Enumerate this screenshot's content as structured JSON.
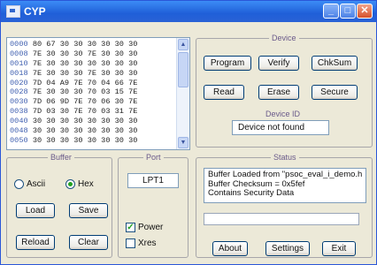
{
  "window": {
    "title": "CYP",
    "icon": "app-icon"
  },
  "hex_view": {
    "lines": [
      {
        "addr": "0000",
        "bytes": "80 67 30 30 30 30 30 30"
      },
      {
        "addr": "0008",
        "bytes": "7E 30 30 30 7E 30 30 30"
      },
      {
        "addr": "0010",
        "bytes": "7E 30 30 30 30 30 30 30"
      },
      {
        "addr": "0018",
        "bytes": "7E 30 30 30 7E 30 30 30"
      },
      {
        "addr": "0020",
        "bytes": "7D 04 A9 7E 70 04 66 7E"
      },
      {
        "addr": "0028",
        "bytes": "7E 30 30 30 70 03 15 7E"
      },
      {
        "addr": "0030",
        "bytes": "7D 06 9D 7E 70 06 30 7E"
      },
      {
        "addr": "0038",
        "bytes": "7D 03 30 7E 70 03 31 7E"
      },
      {
        "addr": "0040",
        "bytes": "30 30 30 30 30 30 30 30"
      },
      {
        "addr": "0048",
        "bytes": "30 30 30 30 30 30 30 30"
      },
      {
        "addr": "0050",
        "bytes": "30 30 30 30 30 30 30 30"
      }
    ]
  },
  "device": {
    "legend": "Device",
    "program_label": "Program",
    "verify_label": "Verify",
    "checksum_label": "ChkSum",
    "read_label": "Read",
    "erase_label": "Erase",
    "secure_label": "Secure",
    "device_id_label": "Device ID",
    "device_id_value": "Device not found"
  },
  "buffer": {
    "legend": "Buffer",
    "ascii_label": "Ascii",
    "hex_label": "Hex",
    "selected": "Hex",
    "load_label": "Load",
    "save_label": "Save",
    "reload_label": "Reload",
    "clear_label": "Clear"
  },
  "port": {
    "legend": "Port",
    "value": "LPT1",
    "power_label": "Power",
    "power_checked": true,
    "xres_label": "Xres",
    "xres_checked": false
  },
  "status": {
    "legend": "Status",
    "lines": [
      "Buffer Loaded from \"psoc_eval_i_demo.h",
      "Buffer Checksum = 0x5fef",
      "Contains Security Data"
    ],
    "progress": ""
  },
  "footer": {
    "about_label": "About",
    "settings_label": "Settings",
    "exit_label": "Exit"
  }
}
